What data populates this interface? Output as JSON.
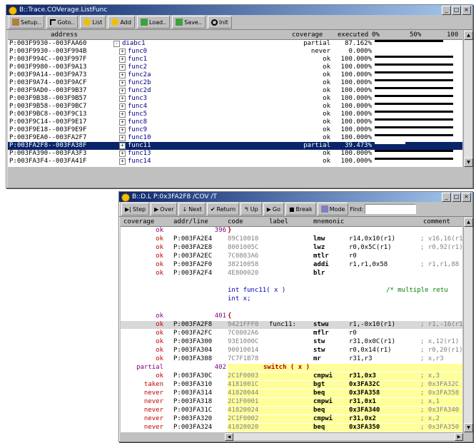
{
  "win1": {
    "title": "B::Trace.COVerage.ListFunc",
    "toolbar": [
      "Setup..",
      "Goto..",
      "List",
      "Add",
      "Load..",
      "Save..",
      "Init"
    ],
    "columns": {
      "address": "address",
      "coverage": "coverage",
      "executed": "executed",
      "pct0": "0%",
      "pct50": "50%",
      "pct100": "100"
    },
    "rows": [
      {
        "addr": "P:003F9930--003FAA60",
        "name": "diabc1",
        "cov": "partial",
        "exec": "87.162%",
        "frac": 0.87,
        "pm": "-",
        "indent": 0
      },
      {
        "addr": "P:003F9930--003F994B",
        "name": "func0",
        "cov": "never",
        "exec": "0.000%",
        "frac": 0,
        "pm": "+",
        "indent": 1
      },
      {
        "addr": "P:003F994C--003F997F",
        "name": "func1",
        "cov": "ok",
        "exec": "100.000%",
        "frac": 1,
        "pm": "+",
        "indent": 1
      },
      {
        "addr": "P:003F9980--003F9A13",
        "name": "func2",
        "cov": "ok",
        "exec": "100.000%",
        "frac": 1,
        "pm": "+",
        "indent": 1
      },
      {
        "addr": "P:003F9A14--003F9A73",
        "name": "func2a",
        "cov": "ok",
        "exec": "100.000%",
        "frac": 1,
        "pm": "+",
        "indent": 1
      },
      {
        "addr": "P:003F9A74--003F9ACF",
        "name": "func2b",
        "cov": "ok",
        "exec": "100.000%",
        "frac": 1,
        "pm": "+",
        "indent": 1
      },
      {
        "addr": "P:003F9AD0--003F9B37",
        "name": "func2d",
        "cov": "ok",
        "exec": "100.000%",
        "frac": 1,
        "pm": "+",
        "indent": 1
      },
      {
        "addr": "P:003F9B38--003F9B57",
        "name": "func3",
        "cov": "ok",
        "exec": "100.000%",
        "frac": 1,
        "pm": "+",
        "indent": 1
      },
      {
        "addr": "P:003F9B58--003F9BC7",
        "name": "func4",
        "cov": "ok",
        "exec": "100.000%",
        "frac": 1,
        "pm": "+",
        "indent": 1
      },
      {
        "addr": "P:003F9BC8--003F9C13",
        "name": "func5",
        "cov": "ok",
        "exec": "100.000%",
        "frac": 1,
        "pm": "+",
        "indent": 1
      },
      {
        "addr": "P:003F9C14--003F9E17",
        "name": "func8",
        "cov": "ok",
        "exec": "100.000%",
        "frac": 1,
        "pm": "+",
        "indent": 1
      },
      {
        "addr": "P:003F9E18--003F9E9F",
        "name": "func9",
        "cov": "ok",
        "exec": "100.000%",
        "frac": 1,
        "pm": "+",
        "indent": 1
      },
      {
        "addr": "P:003F9EA0--003FA2F7",
        "name": "func10",
        "cov": "ok",
        "exec": "100.000%",
        "frac": 1,
        "pm": "+",
        "indent": 1
      },
      {
        "addr": "P:003FA2F8--003FA38F",
        "name": "func11",
        "cov": "partial",
        "exec": "39.473%",
        "frac": 0.39,
        "pm": "+",
        "indent": 1,
        "selected": true
      },
      {
        "addr": "P:003FA390--003FA3F3",
        "name": "func13",
        "cov": "ok",
        "exec": "100.000%",
        "frac": 1,
        "pm": "+",
        "indent": 1
      },
      {
        "addr": "P:003FA3F4--003FA41F",
        "name": "func14",
        "cov": "ok",
        "exec": "100.000%",
        "frac": 1,
        "pm": "+",
        "indent": 1
      }
    ]
  },
  "win2": {
    "title": "B::D.L P:0x3FA2F8 /COV /T",
    "toolbar": [
      "Step",
      "Over",
      "Next",
      "Return",
      "Up",
      "Go",
      "Break",
      "Mode",
      "Find:"
    ],
    "columns": {
      "coverage": "coverage",
      "addr": "addr/line",
      "code": "code",
      "label": "label",
      "mnemonic": "mnemonic",
      "comment": "comment"
    },
    "rows": [
      {
        "cov": "ok",
        "addr": "",
        "line": "396",
        "code": "",
        "label": "",
        "mnem": "",
        "ops": "",
        "comment": "",
        "src": "}",
        "kind": "line"
      },
      {
        "cov": "ok",
        "addr": "P:003FA2E4",
        "code": "89C10010",
        "label": "",
        "mnem": "lmw",
        "ops": "r14,0x10(r1)",
        "comment": "; v16,16(r1"
      },
      {
        "cov": "ok",
        "addr": "P:003FA2E8",
        "code": "8001005C",
        "label": "",
        "mnem": "lwz",
        "ops": "r0,0x5C(r1)",
        "comment": "; r0,92(r1)"
      },
      {
        "cov": "ok",
        "addr": "P:003FA2EC",
        "code": "7C0803A6",
        "label": "",
        "mnem": "mtlr",
        "ops": "r0",
        "comment": ""
      },
      {
        "cov": "ok",
        "addr": "P:003FA2F0",
        "code": "38210058",
        "label": "",
        "mnem": "addi",
        "ops": "r1,r1,0x58",
        "comment": "; r1,r1,88"
      },
      {
        "cov": "ok",
        "addr": "P:003FA2F4",
        "code": "4E800020",
        "label": "",
        "mnem": "blr",
        "ops": "",
        "comment": ""
      },
      {
        "kind": "blank"
      },
      {
        "kind": "src",
        "src": "int func11( x )",
        "comment": "/* multiple retu"
      },
      {
        "kind": "src",
        "src": "int x;"
      },
      {
        "kind": "blank"
      },
      {
        "cov": "ok",
        "line": "401",
        "src": "{",
        "kind": "line"
      },
      {
        "cov": "ok",
        "addr": "P:003FA2F8",
        "code": "9421FFF0",
        "label": "func11:",
        "mnem": "stwu",
        "ops": "r1,-0x10(r1)",
        "comment": "; r1,-16(r1",
        "hl": "gray"
      },
      {
        "cov": "ok",
        "addr": "P:003FA2FC",
        "code": "7C0802A6",
        "label": "",
        "mnem": "mflr",
        "ops": "r0",
        "comment": ""
      },
      {
        "cov": "ok",
        "addr": "P:003FA300",
        "code": "93E1000C",
        "label": "",
        "mnem": "stw",
        "ops": "r31,0x0C(r1)",
        "comment": "; x,12(r1)"
      },
      {
        "cov": "ok",
        "addr": "P:003FA304",
        "code": "90010014",
        "label": "",
        "mnem": "stw",
        "ops": "r0,0x14(r1)",
        "comment": "; r0,20(r1)"
      },
      {
        "cov": "ok",
        "addr": "P:003FA308",
        "code": "7C7F1B78",
        "label": "",
        "mnem": "mr",
        "ops": "r31,r3",
        "comment": "; x,r3"
      },
      {
        "cov": "partial",
        "line": "402",
        "src": "switch ( x )",
        "kind": "line",
        "hl": "yellow"
      },
      {
        "cov": "ok",
        "addr": "P:003FA30C",
        "code": "2C1F0003",
        "label": "",
        "mnem": "cmpwi",
        "ops": "r31,0x3",
        "comment": "; x,3",
        "hl": "yellow"
      },
      {
        "cov": "taken",
        "addr": "P:003FA310",
        "code": "4181001C",
        "label": "",
        "mnem": "bgt",
        "ops": "0x3FA32C",
        "comment": "; 0x3FA32C",
        "hl": "yellow"
      },
      {
        "cov": "never",
        "addr": "P:003FA314",
        "code": "41820044",
        "label": "",
        "mnem": "beq",
        "ops": "0x3FA358",
        "comment": "; 0x3FA358",
        "hl": "yellow"
      },
      {
        "cov": "never",
        "addr": "P:003FA318",
        "code": "2C1F0001",
        "label": "",
        "mnem": "cmpwi",
        "ops": "r31,0x1",
        "comment": "; x,1",
        "hl": "yellow"
      },
      {
        "cov": "never",
        "addr": "P:003FA31C",
        "code": "41820024",
        "label": "",
        "mnem": "beq",
        "ops": "0x3FA340",
        "comment": "; 0x3FA340",
        "hl": "yellow"
      },
      {
        "cov": "never",
        "addr": "P:003FA320",
        "code": "2C1F0002",
        "label": "",
        "mnem": "cmpwi",
        "ops": "r31,0x2",
        "comment": "; x,2",
        "hl": "yellow"
      },
      {
        "cov": "never",
        "addr": "P:003FA324",
        "code": "41820020",
        "label": "",
        "mnem": "beq",
        "ops": "0x3FA350",
        "comment": "; 0x3FA350",
        "hl": "yellow"
      }
    ]
  },
  "colors": {
    "titlebar": "#0a246a",
    "selection": "#0a246a",
    "highlight": "#ffff99",
    "red": "#c00000"
  }
}
